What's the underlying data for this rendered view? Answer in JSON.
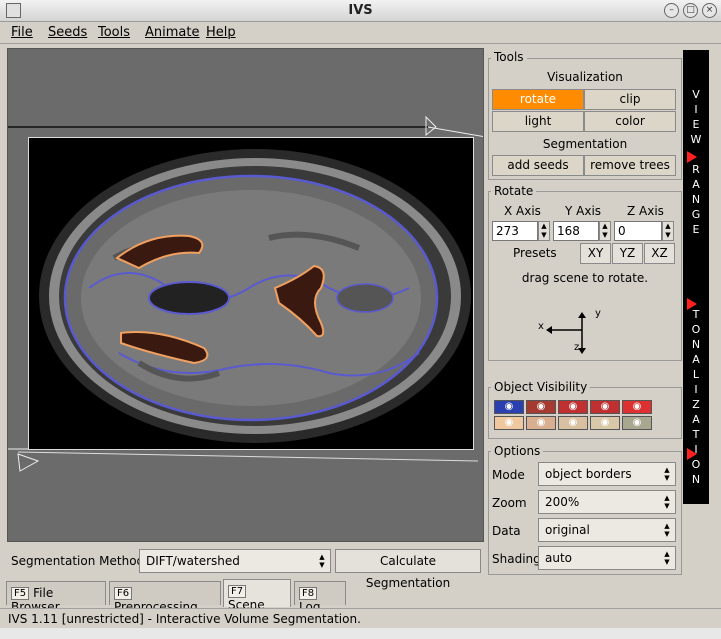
{
  "window": {
    "title": "IVS"
  },
  "menu": [
    "File",
    "Seeds",
    "Tools",
    "Animate",
    "Help"
  ],
  "tools": {
    "group_title": "Tools",
    "visualization_heading": "Visualization",
    "buttons": {
      "rotate": "rotate",
      "clip": "clip",
      "light": "light",
      "color": "color"
    },
    "active": "rotate",
    "segmentation_heading": "Segmentation",
    "seg_buttons": {
      "add_seeds": "add seeds",
      "remove_trees": "remove trees"
    }
  },
  "rotate": {
    "group_title": "Rotate",
    "axes": [
      {
        "label": "X Axis",
        "value": "273"
      },
      {
        "label": "Y Axis",
        "value": "168"
      },
      {
        "label": "Z Axis",
        "value": "0"
      }
    ],
    "presets_label": "Presets",
    "presets": [
      "XY",
      "YZ",
      "XZ"
    ],
    "hint": "drag scene to rotate.",
    "axis_glyphs": {
      "x": "x",
      "y": "y",
      "z": "z"
    }
  },
  "object_visibility": {
    "group_title": "Object Visibility",
    "rows": [
      [
        "#2a3fb0",
        "#a43a30",
        "#c03030",
        "#c03030",
        "#dd3030"
      ],
      [
        "#f0c8a0",
        "#d8b090",
        "#d8c0a0",
        "#d8c8a8",
        "#a8a890"
      ]
    ]
  },
  "options": {
    "group_title": "Options",
    "fields": [
      {
        "label": "Mode",
        "value": "object borders"
      },
      {
        "label": "Zoom",
        "value": "200%"
      },
      {
        "label": "Data",
        "value": "original"
      },
      {
        "label": "Shading",
        "value": "auto"
      }
    ]
  },
  "sidebar": {
    "view_range": [
      "V",
      "I",
      "E",
      "W",
      "",
      "R",
      "A",
      "N",
      "G",
      "E"
    ],
    "tonalization": [
      "T",
      "O",
      "N",
      "A",
      "L",
      "I",
      "Z",
      "A",
      "T",
      "I",
      "O",
      "N"
    ]
  },
  "bottom": {
    "seg_method_label": "Segmentation Method:",
    "seg_method_value": "DIFT/watershed",
    "calc_button": "Calculate Segmentation"
  },
  "tabs": [
    {
      "key": "F5",
      "label": "File Browser"
    },
    {
      "key": "F6",
      "label": "Preprocessing"
    },
    {
      "key": "F7",
      "label": "Scene",
      "active": true
    },
    {
      "key": "F8",
      "label": "Log"
    }
  ],
  "status": "IVS 1.11 [unrestricted] - Interactive Volume Segmentation.",
  "colors": {
    "accent": "#ff8c00",
    "panel": "#d4d0c8",
    "border_blue": "#5a5ad0",
    "ventricle_border": "#f0a060"
  }
}
